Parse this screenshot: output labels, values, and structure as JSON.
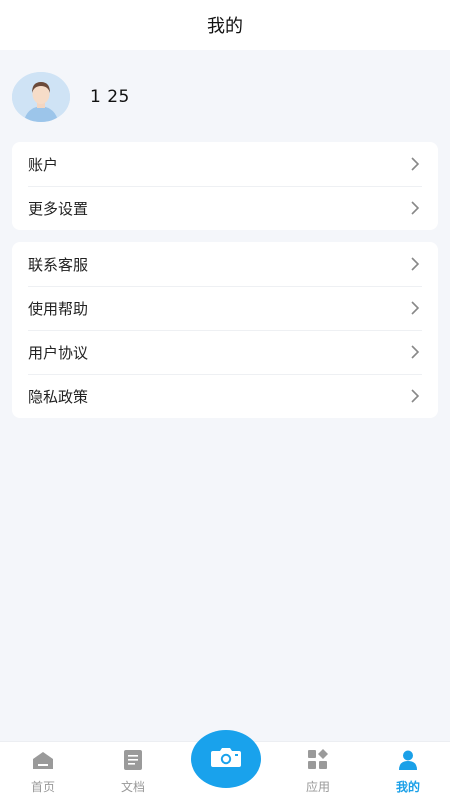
{
  "header": {
    "title": "我的"
  },
  "profile": {
    "username": "1            25"
  },
  "menu_group_1": [
    {
      "label": "账户"
    },
    {
      "label": "更多设置"
    }
  ],
  "menu_group_2": [
    {
      "label": "联系客服"
    },
    {
      "label": "使用帮助"
    },
    {
      "label": "用户协议"
    },
    {
      "label": "隐私政策"
    }
  ],
  "tabbar": {
    "home": "首页",
    "docs": "文档",
    "apps": "应用",
    "mine": "我的"
  },
  "colors": {
    "accent": "#1aa0e8",
    "camera_button": "#19a2ec",
    "background": "#f4f6fa",
    "inactive_tab": "#999999"
  }
}
